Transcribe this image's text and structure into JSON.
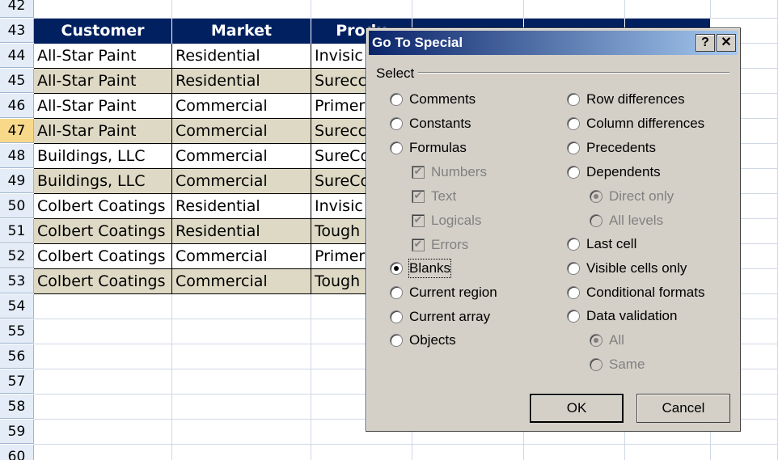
{
  "sheet": {
    "headers": [
      "Customer",
      "Market",
      "Produ",
      "",
      "",
      ""
    ],
    "rows": [
      {
        "num": "42",
        "cells": [
          "",
          "",
          "",
          "",
          "",
          ""
        ]
      },
      {
        "num": "43",
        "cells": []
      },
      {
        "num": "44",
        "cells": [
          "All-Star Paint",
          "Residential",
          "Invisic",
          "",
          "",
          ""
        ]
      },
      {
        "num": "45",
        "cells": [
          "All-Star Paint",
          "Residential",
          "Surecc",
          "",
          "",
          ""
        ]
      },
      {
        "num": "46",
        "cells": [
          "All-Star Paint",
          "Commercial",
          "Primer",
          "",
          "",
          ""
        ]
      },
      {
        "num": "47",
        "cells": [
          "All-Star Paint",
          "Commercial",
          "Surecc",
          "",
          "",
          ""
        ]
      },
      {
        "num": "48",
        "cells": [
          "Buildings, LLC",
          "Commercial",
          "SureCo",
          "",
          "",
          ""
        ]
      },
      {
        "num": "49",
        "cells": [
          "Buildings, LLC",
          "Commercial",
          "SureCo",
          "",
          "",
          ""
        ]
      },
      {
        "num": "50",
        "cells": [
          "Colbert Coatings",
          "Residential",
          "Invisic",
          "",
          "",
          ""
        ]
      },
      {
        "num": "51",
        "cells": [
          "Colbert Coatings",
          "Residential",
          "Tough",
          "",
          "",
          ""
        ]
      },
      {
        "num": "52",
        "cells": [
          "Colbert Coatings",
          "Commercial",
          "Primer",
          "",
          "",
          ""
        ]
      },
      {
        "num": "53",
        "cells": [
          "Colbert Coatings",
          "Commercial",
          "Tough",
          "",
          "",
          ""
        ]
      },
      {
        "num": "54",
        "cells": []
      },
      {
        "num": "55",
        "cells": []
      },
      {
        "num": "56",
        "cells": []
      },
      {
        "num": "57",
        "cells": []
      },
      {
        "num": "58",
        "cells": []
      },
      {
        "num": "59",
        "cells": []
      },
      {
        "num": "60",
        "cells": []
      }
    ],
    "selected_row": "47",
    "colors": {
      "header_bg": "#002060",
      "shade": "#ddd9c4",
      "selected_row_header": "#f8d98a"
    }
  },
  "dialog": {
    "title": "Go To Special",
    "help_label": "?",
    "close_label": "✕",
    "group_label": "Select",
    "left_options": [
      {
        "label": "Comments",
        "type": "radio",
        "checked": false,
        "disabled": false
      },
      {
        "label": "Constants",
        "type": "radio",
        "checked": false,
        "disabled": false
      },
      {
        "label": "Formulas",
        "type": "radio",
        "checked": false,
        "disabled": false
      },
      {
        "label": "Numbers",
        "type": "checkbox",
        "checked": true,
        "disabled": true
      },
      {
        "label": "Text",
        "type": "checkbox",
        "checked": true,
        "disabled": true
      },
      {
        "label": "Logicals",
        "type": "checkbox",
        "checked": true,
        "disabled": true
      },
      {
        "label": "Errors",
        "type": "checkbox",
        "checked": true,
        "disabled": true
      },
      {
        "label": "Blanks",
        "type": "radio",
        "checked": true,
        "disabled": false
      },
      {
        "label": "Current region",
        "type": "radio",
        "checked": false,
        "disabled": false
      },
      {
        "label": "Current array",
        "type": "radio",
        "checked": false,
        "disabled": false
      },
      {
        "label": "Objects",
        "type": "radio",
        "checked": false,
        "disabled": false
      }
    ],
    "right_options": [
      {
        "label": "Row differences",
        "type": "radio",
        "checked": false,
        "disabled": false
      },
      {
        "label": "Column differences",
        "type": "radio",
        "checked": false,
        "disabled": false
      },
      {
        "label": "Precedents",
        "type": "radio",
        "checked": false,
        "disabled": false
      },
      {
        "label": "Dependents",
        "type": "radio",
        "checked": false,
        "disabled": false
      },
      {
        "label": "Direct only",
        "type": "radio",
        "checked": true,
        "disabled": true
      },
      {
        "label": "All levels",
        "type": "radio",
        "checked": false,
        "disabled": true
      },
      {
        "label": "Last cell",
        "type": "radio",
        "checked": false,
        "disabled": false
      },
      {
        "label": "Visible cells only",
        "type": "radio",
        "checked": false,
        "disabled": false
      },
      {
        "label": "Conditional formats",
        "type": "radio",
        "checked": false,
        "disabled": false
      },
      {
        "label": "Data validation",
        "type": "radio",
        "checked": false,
        "disabled": false
      },
      {
        "label": "All",
        "type": "radio",
        "checked": true,
        "disabled": true
      },
      {
        "label": "Same",
        "type": "radio",
        "checked": false,
        "disabled": true
      }
    ],
    "ok_label": "OK",
    "cancel_label": "Cancel"
  }
}
